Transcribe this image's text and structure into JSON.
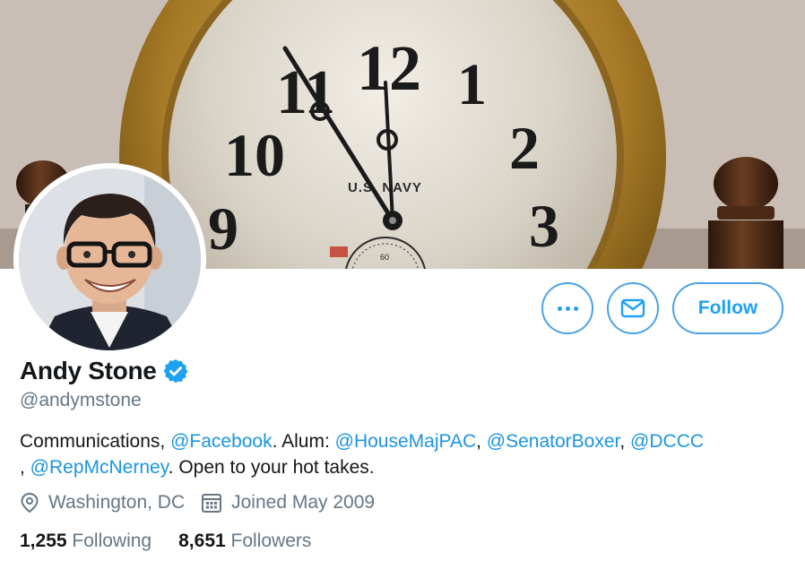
{
  "banner": {
    "clock_text": "U.S. NAVY",
    "clock_numerals": [
      "12",
      "1",
      "2",
      "3",
      "9",
      "10",
      "11"
    ],
    "clock_subdial": "60"
  },
  "profile": {
    "display_name": "Andy Stone",
    "verified": true,
    "handle": "@andymstone",
    "bio": {
      "t1": "Communications, ",
      "m1": "@Facebook",
      "t2": ". Alum: ",
      "m2": "@HouseMajPAC",
      "t3": ", ",
      "m3": "@SenatorBoxer",
      "t4": ", ",
      "m4": "@DCCC",
      "t5": ", ",
      "m5": "@RepMcNerney",
      "t6": ". Open to your hot takes."
    },
    "location": "Washington, DC",
    "joined": "Joined May 2009"
  },
  "stats": {
    "following_count": "1,255",
    "following_label": "Following",
    "followers_count": "8,651",
    "followers_label": "Followers"
  },
  "actions": {
    "follow_label": "Follow",
    "more_icon": "more-dots-icon",
    "message_icon": "envelope-icon"
  },
  "colors": {
    "accent": "#1da1f2",
    "link": "#1b95e0",
    "muted": "#657786",
    "text": "#14171a",
    "verified": "#1da1f2"
  }
}
